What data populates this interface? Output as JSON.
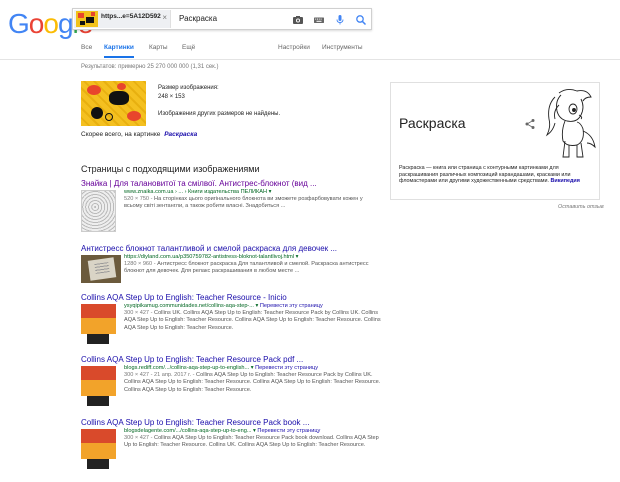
{
  "logo": {
    "text": "Google",
    "letters": [
      {
        "ch": "G",
        "color": "#4285f4"
      },
      {
        "ch": "o",
        "color": "#ea4335"
      },
      {
        "ch": "o",
        "color": "#fbbc05"
      },
      {
        "ch": "g",
        "color": "#4285f4"
      },
      {
        "ch": "l",
        "color": "#34a853"
      },
      {
        "ch": "e",
        "color": "#ea4335"
      }
    ]
  },
  "search": {
    "chip_label": "https...e=5A12D592",
    "chip_close": "×",
    "query": "Раскраска",
    "icons": [
      "camera-icon",
      "keyboard-icon",
      "mic-icon",
      "search-icon"
    ]
  },
  "tabs": {
    "all": "Все",
    "images": "Картинки",
    "maps": "Карты",
    "more": "Ещё",
    "settings": "Настройки",
    "tools": "Инструменты"
  },
  "stats": "Результатов: примерно 25 270 000 000 (1,31 сек.)",
  "image_info": {
    "size_label": "Размер изображения:",
    "size_value": "248 × 153",
    "not_found": "Изображения других размеров не найдены."
  },
  "best_guess": {
    "label": "Скорее всего, на картинке",
    "link": "Раскраска"
  },
  "section_title": "Страницы с подходящими изображениями",
  "results": [
    {
      "title": "Знайка | Для талановитої та смілвої. Антистрес-блокнот (вид ...",
      "url": "www.znaika.com.ua › ... › Книги издательства ПЕЛИКАН ▾",
      "translate": "",
      "meta": "520 × 750 -",
      "snippet": "На сторінках цього оригінального блокнота ви зможете розфарбовувати кожен у всьому світі зентангли, а також робити власні. Знадобиться ..."
    },
    {
      "title": "Антистресс блокнот талантливой и смелой раскраска для девочек ...",
      "url": "https://diyland.com.ua/p350759782-antistress-bloknot-talantlivoj.html ▾",
      "translate": "",
      "meta": "1280 × 960 -",
      "snippet": "Антистресс блокнот раскраска Для талантливой и смелой. Раскраска антистресс блокнот для девочек. Для релакс раскрашивания в любом месте ..."
    },
    {
      "title": "Collins AQA Step Up to English: Teacher Resource - Inicio",
      "url": "ysyqipikamug.communidades.net/collins-aqa-step-... ▾",
      "translate": "Перевести эту страницу",
      "meta": "300 × 427 -",
      "snippet": "Collins UK. Collins AQA Step Up to English: Teacher Resource Pack by Collins UK. Collins AQA Step Up to English: Teacher Resource. Collins AQA Step Up to English: Teacher Resource. Collins AQA Step Up to English: Teacher Resource."
    },
    {
      "title": "Collins AQA Step Up to English: Teacher Resource Pack pdf ...",
      "url": "blogs.rediff.com/.../collins-aqa-step-up-to-english... ▾",
      "translate": "Перевести эту страницу",
      "meta": "300 × 427 - 21 апр. 2017 г. -",
      "snippet": "Collins AQA Step Up to English: Teacher Resource Pack by Collins UK. Collins AQA Step Up to English: Teacher Resource. Collins AQA Step Up to English: Teacher Resource. Collins AQA Step Up to English: Teacher Resource."
    },
    {
      "title": "Collins AQA Step Up to English: Teacher Resource Pack book ...",
      "url": "blogsdelagente.com/.../collins-aqa-step-up-to-eng... ▾",
      "translate": "Перевести эту страницу",
      "meta": "300 × 427 -",
      "snippet": "Collins AQA Step Up to English: Teacher Resource Pack book download. Collins AQA Step Up to English: Teacher Resource. Collins UK. Collins AQA Step Up to English: Teacher Resource."
    }
  ],
  "knowledge_panel": {
    "title": "Раскраска",
    "description": "Раскраска — книга или страница с контурными картинками для раскрашивания различных композиций карандашами, красками или фломастерами или другими художественными средствами.",
    "source": "Википедия"
  },
  "feedback": "Оставить отзыв",
  "colors": {
    "link": "#1a0dab",
    "visited": "#660099",
    "url": "#006621",
    "accent": "#1a73e8"
  }
}
